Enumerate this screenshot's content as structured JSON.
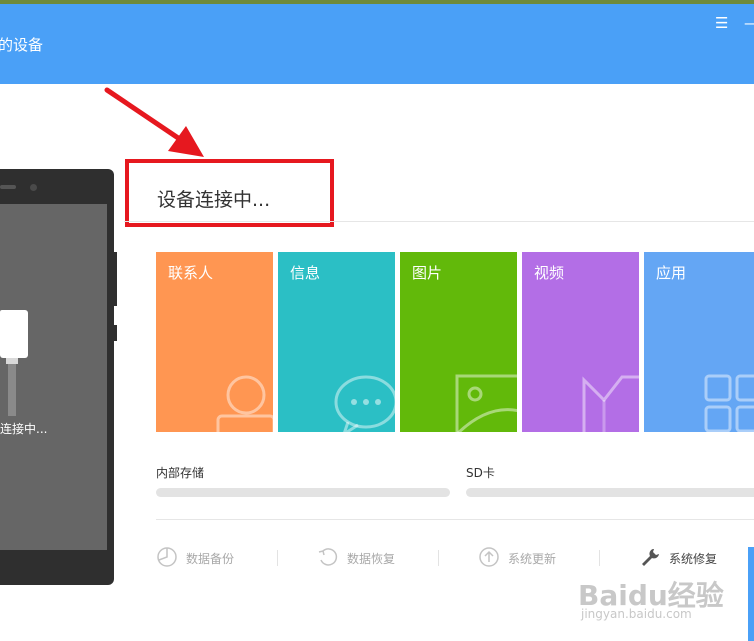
{
  "header": {
    "title": "的设备",
    "menu_glyph": "☰",
    "minimize_glyph": "—",
    "background_color": "#4aa0f7"
  },
  "phone": {
    "status_text": "连接中..."
  },
  "main": {
    "connection_status": "设备连接中...",
    "annotation_color": "#e6181f",
    "tiles": [
      {
        "label": "联系人",
        "icon": "contact-icon",
        "color": "#ff9652"
      },
      {
        "label": "信息",
        "icon": "message-icon",
        "color": "#2bbfc5"
      },
      {
        "label": "图片",
        "icon": "picture-icon",
        "color": "#62b90a"
      },
      {
        "label": "视频",
        "icon": "video-icon",
        "color": "#b36ee6"
      },
      {
        "label": "应用",
        "icon": "apps-icon",
        "color": "#64a6f4"
      }
    ],
    "storage": {
      "internal_label": "内部存储",
      "sd_label": "SD卡"
    },
    "tools": [
      {
        "label": "数据备份",
        "icon": "backup-icon",
        "enabled": false
      },
      {
        "label": "数据恢复",
        "icon": "restore-icon",
        "enabled": false
      },
      {
        "label": "系统更新",
        "icon": "update-icon",
        "enabled": false
      },
      {
        "label": "系统修复",
        "icon": "wrench-icon",
        "enabled": true
      }
    ]
  },
  "watermark": {
    "brand": "Baidu经验",
    "url": "jingyan.baidu.com"
  }
}
